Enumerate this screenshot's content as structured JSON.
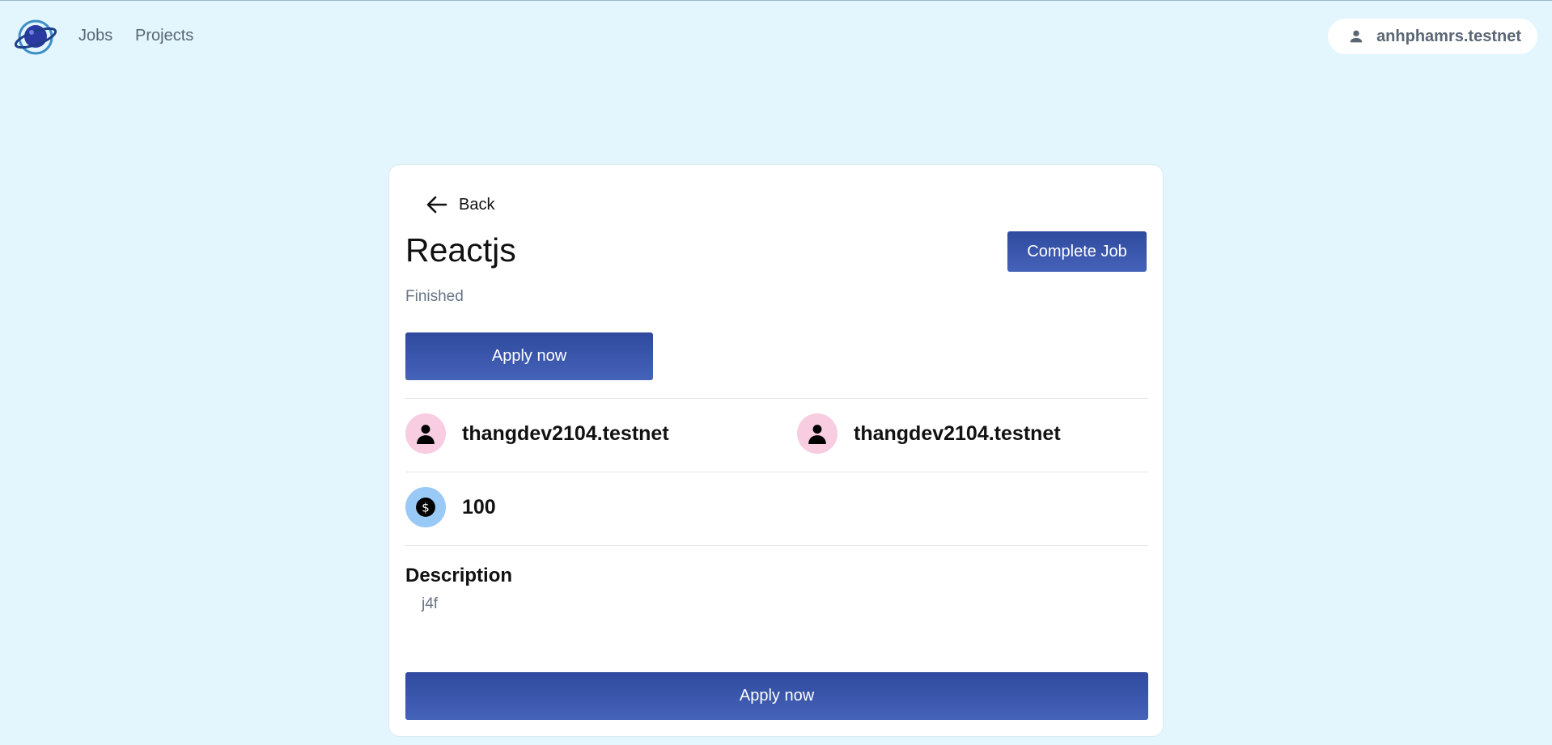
{
  "nav": {
    "logo": "planet-logo-icon",
    "links": [
      "Jobs",
      "Projects"
    ],
    "user": {
      "icon": "person-icon",
      "name": "anhphamrs.testnet"
    }
  },
  "job": {
    "back_label": "Back",
    "title": "Reactjs",
    "complete_label": "Complete Job",
    "status": "Finished",
    "apply_label": "Apply now",
    "owner": "thangdev2104.testnet",
    "worker": "thangdev2104.testnet",
    "budget": "100",
    "description_heading": "Description",
    "description": "j4f"
  },
  "colors": {
    "background": "#e3f5fd",
    "primary_button": "#3a56ab",
    "avatar_bg": "#f8cde2",
    "coin_bg": "#99c9f7",
    "muted_text": "#667587"
  }
}
